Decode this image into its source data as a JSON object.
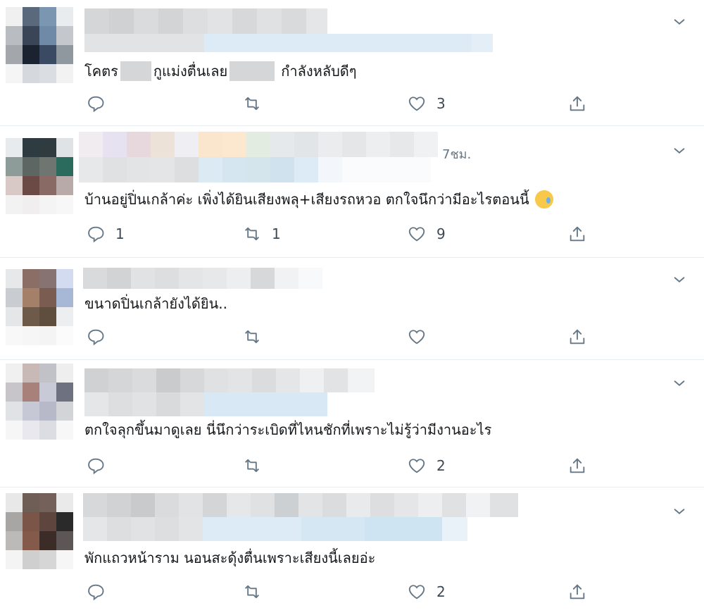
{
  "colors": {
    "accent": "#1da1f2",
    "icon": "#657786",
    "divider": "#e6ecf0"
  },
  "tweets": [
    {
      "body": [
        "โคตร",
        "กูแม่งตื่นเลย",
        "กำลังหลับดีๆ"
      ],
      "timestamp": "",
      "reply_count": "",
      "retweet_count": "",
      "like_count": "3"
    },
    {
      "body": [
        "บ้านอยู่ปิ่นเกล้าค่ะ เพิ่งได้ยินเสียงพลุ+เสียงรถหวอ ตกใจนึกว่ามีอะไรตอนนี้"
      ],
      "emoji": "anxious-face-with-sweat",
      "timestamp": "7ชม.",
      "reply_count": "1",
      "retweet_count": "1",
      "like_count": "9"
    },
    {
      "body": [
        "ขนาดปิ่นเกล้ายังได้ยิน.."
      ],
      "timestamp": "",
      "reply_count": "",
      "retweet_count": "",
      "like_count": ""
    },
    {
      "body": [
        "ตกใจลุกขึ้นมาดูเลย  นี่นึกว่าระเบิดที่ไหนชักที่เพราะไม่รู้ว่ามีงานอะไร"
      ],
      "timestamp": "",
      "reply_count": "",
      "retweet_count": "",
      "like_count": "2"
    },
    {
      "body": [
        "พักแถวหน้าราม นอนสะดุ้งตื่นเพราะเสียงนี้เลยอ่ะ"
      ],
      "timestamp": "",
      "reply_count": "",
      "retweet_count": "",
      "like_count": "2"
    }
  ],
  "icons": {
    "reply": "reply-icon",
    "retweet": "retweet-icon",
    "like": "heart-icon",
    "share": "share-icon",
    "more": "chevron-down-icon"
  }
}
